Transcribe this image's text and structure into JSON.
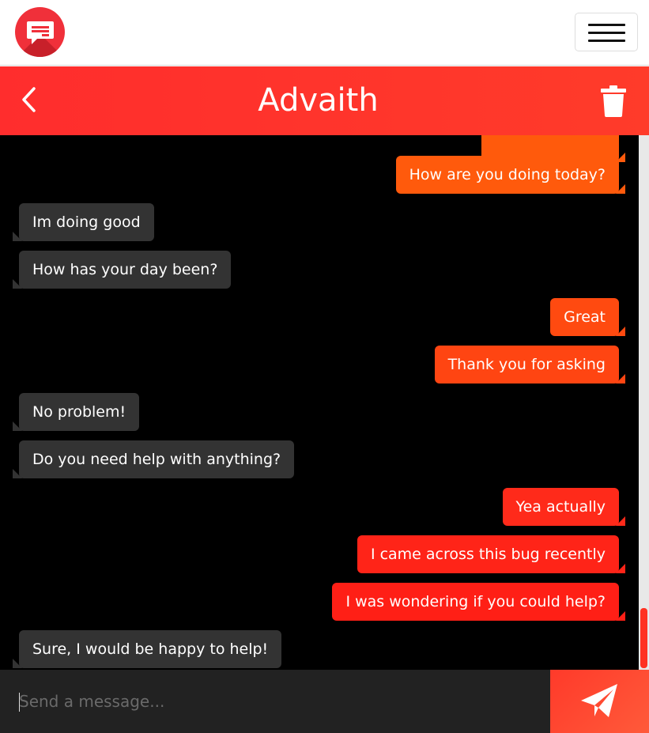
{
  "app": {
    "logo_icon": "chat-bubble-icon",
    "menu_icon": "hamburger-menu-icon"
  },
  "header": {
    "title": "Advaith",
    "back_icon": "chevron-left-icon",
    "delete_icon": "trash-icon",
    "color": "#ff2d2d"
  },
  "messages": [
    {
      "sender": "me",
      "text": ""
    },
    {
      "sender": "me",
      "text": "How are you doing today?"
    },
    {
      "sender": "them",
      "text": "Im doing good"
    },
    {
      "sender": "them",
      "text": "How has your day been?"
    },
    {
      "sender": "me",
      "text": "Great"
    },
    {
      "sender": "me",
      "text": "Thank you for asking"
    },
    {
      "sender": "them",
      "text": "No problem!"
    },
    {
      "sender": "them",
      "text": "Do you need help with anything?"
    },
    {
      "sender": "me",
      "text": "Yea actually"
    },
    {
      "sender": "me",
      "text": "I came across this bug recently"
    },
    {
      "sender": "me",
      "text": "I was wondering if you could help?"
    },
    {
      "sender": "them",
      "text": "Sure, I would be happy to help!"
    }
  ],
  "composer": {
    "placeholder": "Send a message...",
    "value": "",
    "send_icon": "paper-plane-icon"
  },
  "colors": {
    "outgoing_top": "#ff6a00",
    "outgoing_bottom": "#ff1f1f",
    "incoming": "#333333",
    "background": "#000000"
  }
}
